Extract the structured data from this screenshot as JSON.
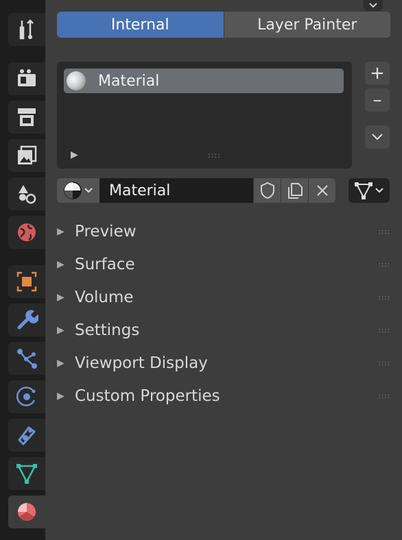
{
  "tabs": [
    {
      "icon": "tool-icon",
      "color": "#d6d6d6"
    },
    {
      "icon": "render-icon",
      "color": "#d6d6d6"
    },
    {
      "icon": "output-icon",
      "color": "#d6d6d6"
    },
    {
      "icon": "view-layer-icon",
      "color": "#d6d6d6"
    },
    {
      "icon": "scene-icon",
      "color": "#d6d6d6"
    },
    {
      "icon": "world-icon",
      "color": "#d25a5a"
    },
    {
      "icon": "object-icon",
      "color": "#e08a43"
    },
    {
      "icon": "modifier-icon",
      "color": "#6b93d6"
    },
    {
      "icon": "particles-icon",
      "color": "#6b93d6"
    },
    {
      "icon": "physics-icon",
      "color": "#6b93d6"
    },
    {
      "icon": "constraints-icon",
      "color": "#6b93d6"
    },
    {
      "icon": "object-data-icon",
      "color": "#2fc4a6"
    },
    {
      "icon": "material-icon",
      "color": "#e86a6a"
    }
  ],
  "mode_switch": {
    "internal": "Internal",
    "layer_painter": "Layer Painter"
  },
  "slot_list": {
    "items": [
      {
        "label": "Material"
      }
    ],
    "add": "+",
    "remove": "–"
  },
  "material_selector": {
    "name": "Material"
  },
  "sections": [
    {
      "label": "Preview"
    },
    {
      "label": "Surface"
    },
    {
      "label": "Volume"
    },
    {
      "label": "Settings"
    },
    {
      "label": "Viewport Display"
    },
    {
      "label": "Custom Properties"
    }
  ]
}
